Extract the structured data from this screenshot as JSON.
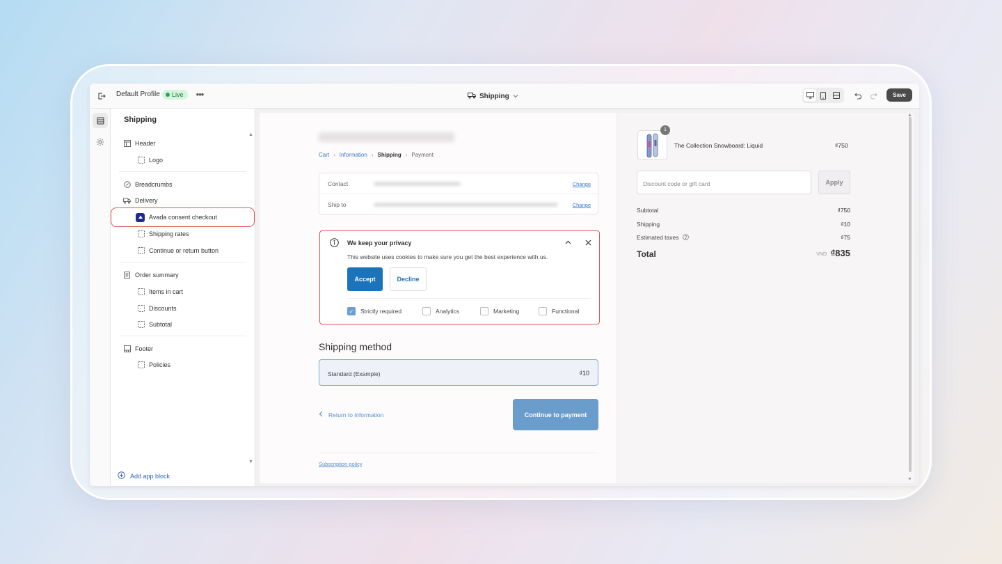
{
  "topbar": {
    "profile": "Default Profile",
    "status": "Live",
    "page": "Shipping",
    "save": "Save"
  },
  "sidebar": {
    "title": "Shipping",
    "items": [
      {
        "label": "Header",
        "icon": "layout-icon"
      },
      {
        "label": "Logo",
        "icon": "block-icon"
      },
      {
        "label": "Breadcrumbs",
        "icon": "breadcrumb-icon"
      },
      {
        "label": "Delivery",
        "icon": "truck-icon"
      },
      {
        "label": "Avada consent checkout",
        "icon": "app-icon"
      },
      {
        "label": "Shipping rates",
        "icon": "block-icon"
      },
      {
        "label": "Continue or return button",
        "icon": "block-icon"
      },
      {
        "label": "Order summary",
        "icon": "summary-icon"
      },
      {
        "label": "Items in cart",
        "icon": "block-icon"
      },
      {
        "label": "Discounts",
        "icon": "block-icon"
      },
      {
        "label": "Subtotal",
        "icon": "block-icon"
      },
      {
        "label": "Footer",
        "icon": "footer-icon"
      },
      {
        "label": "Policies",
        "icon": "block-icon"
      }
    ],
    "add_block": "Add app block"
  },
  "preview": {
    "breadcrumbs": {
      "cart": "Cart",
      "information": "Information",
      "shipping": "Shipping",
      "payment": "Payment"
    },
    "contact_label": "Contact",
    "shipto_label": "Ship to",
    "change": "Change",
    "consent": {
      "title": "We keep your privacy",
      "text": "This website uses cookies to make sure you get the best experience with us.",
      "accept": "Accept",
      "decline": "Decline",
      "options": [
        "Strictly required",
        "Analytics",
        "Marketing",
        "Functional"
      ],
      "checked": "Strictly required"
    },
    "shipping_method_title": "Shipping method",
    "shipping_option": {
      "name": "Standard (Example)",
      "price": "₫10"
    },
    "return_link": "Return to information",
    "continue_button": "Continue to payment",
    "subscription_policy": "Subscription policy"
  },
  "summary": {
    "product_qty": "1",
    "product_name": "The Collection Snowboard: Liquid",
    "product_price": "₫750",
    "discount_placeholder": "Discount code or gift card",
    "apply": "Apply",
    "subtotal_label": "Subtotal",
    "subtotal_value": "₫750",
    "shipping_label": "Shipping",
    "shipping_value": "₫10",
    "taxes_label": "Estimated taxes",
    "taxes_value": "₫75",
    "total_label": "Total",
    "total_currency": "VND",
    "total_value": "₫835"
  },
  "colors": {
    "accent": "#1b73b9",
    "highlight_border": "#e05252",
    "live_badge": "#d4f5dc"
  }
}
